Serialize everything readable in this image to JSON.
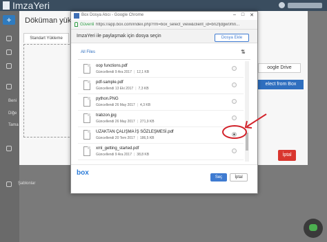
{
  "app": {
    "logo": "ImzaYeri",
    "add": "+",
    "sidebar_labels": [
      "Beni",
      "Diğe",
      "Tama"
    ],
    "sablonlar": "Şablonlar"
  },
  "bg_modal": {
    "title": "Döküman yükle",
    "tab": "Standart Yükleme",
    "google_drive": "oogle Drive",
    "select_from_box": "elect from Box",
    "iptal": "İptal"
  },
  "chrome": {
    "title": "Box Dosya Atıcı - Google Chrome",
    "secure": "Güvenli",
    "url": "https://app.box.com/index.php?rm=box_select_view&client_id=bn2fjdgw0mn..."
  },
  "box": {
    "title": "ImzaYeri ile paylaşmak için dosya seçin",
    "add_file": "Dosya Ekle",
    "all_files": "All Files",
    "sort_icon": "sort-icon",
    "logo": "box",
    "select": "Seç",
    "cancel": "İptal",
    "files": [
      {
        "name": "oop functions.pdf",
        "updated": "Güncellendi",
        "date": "9 Ara 2017",
        "size": "12,1 KB",
        "selected": false
      },
      {
        "name": "pdf-sample.pdf",
        "updated": "Güncellendi",
        "date": "13 Eki 2017",
        "size": "7,3 KB",
        "selected": false
      },
      {
        "name": "python.PNG",
        "updated": "Güncellendi",
        "date": "26 May 2017",
        "size": "4,3 KB",
        "selected": false
      },
      {
        "name": "trabzon.jpg",
        "updated": "Güncellendi",
        "date": "26 May 2017",
        "size": "271,9 KB",
        "selected": false
      },
      {
        "name": "UZAKTAN ÇALIŞMA İŞ SÖZLEŞMESİ.pdf",
        "updated": "Güncellendi",
        "date": "20 Tem 2017",
        "size": "186,5 KB",
        "selected": true
      },
      {
        "name": "xml_getting_started.pdf",
        "updated": "Güncellendi",
        "date": "9 Ara 2017",
        "size": "38,8 KB",
        "selected": false
      }
    ]
  },
  "colors": {
    "accent": "#3f7bd1",
    "annotation": "#d3222a",
    "secure": "#2e9e44"
  }
}
